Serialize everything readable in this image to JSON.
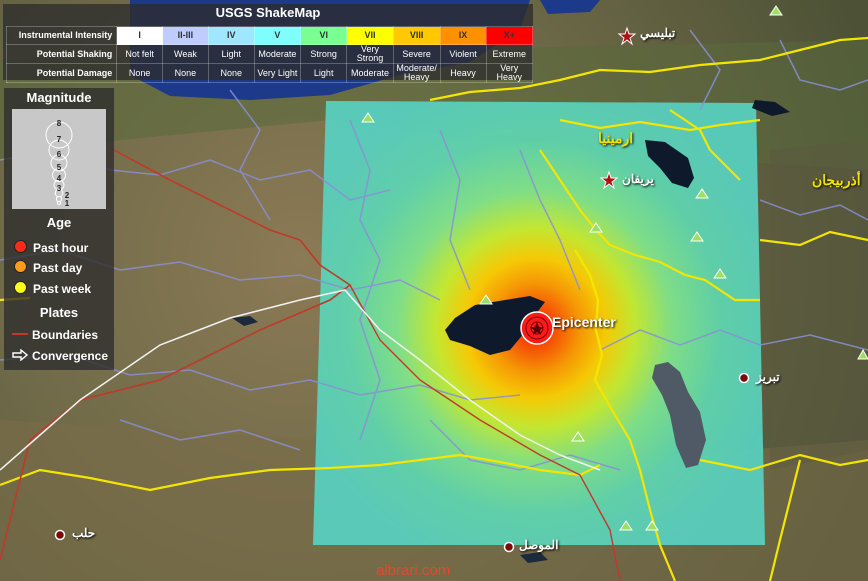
{
  "shakemap": {
    "title": "USGS ShakeMap",
    "row_labels": [
      "Instrumental Intensity",
      "Potential Shaking",
      "Potential Damage"
    ],
    "intensity": [
      "I",
      "II-III",
      "IV",
      "V",
      "VI",
      "VII",
      "VIII",
      "IX",
      "X+"
    ],
    "intensity_colors": [
      "#ffffff",
      "#bfccff",
      "#a0e6ff",
      "#80ffff",
      "#7aff93",
      "#ffff00",
      "#ffc800",
      "#ff9100",
      "#ff0000"
    ],
    "shaking": [
      "Not felt",
      "Weak",
      "Light",
      "Moderate",
      "Strong",
      "Very Strong",
      "Severe",
      "Violent",
      "Extreme"
    ],
    "damage": [
      "None",
      "None",
      "None",
      "Very Light",
      "Light",
      "Moderate",
      "Moderate/ Heavy",
      "Heavy",
      "Very Heavy"
    ]
  },
  "legend": {
    "magnitude_title": "Magnitude",
    "magnitudes": [
      "8",
      "7",
      "6",
      "5",
      "4",
      "3",
      "2",
      "1"
    ],
    "age_title": "Age",
    "age": [
      {
        "label": "Past hour",
        "color": "#ff2a1a"
      },
      {
        "label": "Past day",
        "color": "#ff9b1a"
      },
      {
        "label": "Past week",
        "color": "#ffff1a"
      }
    ],
    "plates_title": "Plates",
    "boundaries_label": "Boundaries",
    "convergence_label": "Convergence",
    "boundary_color": "#c0392b"
  },
  "map": {
    "epicenter_label": "Epicenter",
    "cities": {
      "tbilisi": "تبليسي",
      "yerevan": "يريفان",
      "tabriz": "تبريز",
      "mosul": "الموصل",
      "aleppo": "حلب"
    },
    "regions": {
      "armenia": "ارمينيا",
      "azerbaijan": "أذربيجان"
    },
    "watermark": "albrari.com"
  }
}
